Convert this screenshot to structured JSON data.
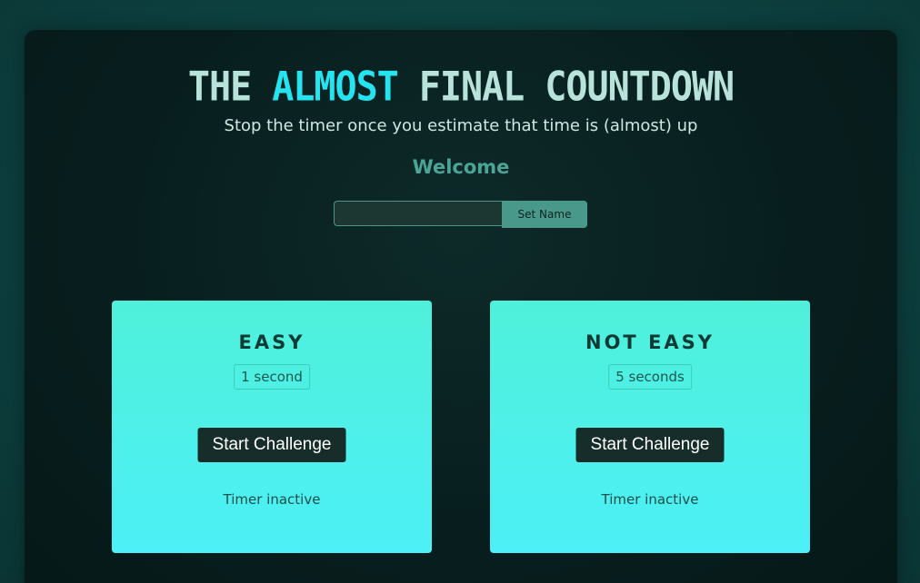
{
  "header": {
    "title_part1": "THE ",
    "title_highlight": "ALMOST",
    "title_part2": " FINAL COUNTDOWN",
    "subtitle": "Stop the timer once you estimate that time is (almost) up",
    "welcome": "Welcome"
  },
  "name_form": {
    "input_value": "",
    "input_placeholder": "",
    "button_label": "Set Name"
  },
  "challenges": [
    {
      "title": "EASY",
      "duration": "1 second",
      "button_label": "Start Challenge",
      "status": "Timer inactive"
    },
    {
      "title": "NOT EASY",
      "duration": "5 seconds",
      "button_label": "Start Challenge",
      "status": "Timer inactive"
    }
  ],
  "colors": {
    "page_background": "#0c3f3e",
    "panel_background": "#081e1e",
    "title_text": "#b8e3da",
    "title_highlight": "#24e4f0",
    "welcome_text": "#4aa596",
    "card_gradient_top": "#4ff0da",
    "card_gradient_bottom": "#4cf0f6",
    "button_dark": "#172d2a",
    "set_name_button": "#48998a"
  }
}
